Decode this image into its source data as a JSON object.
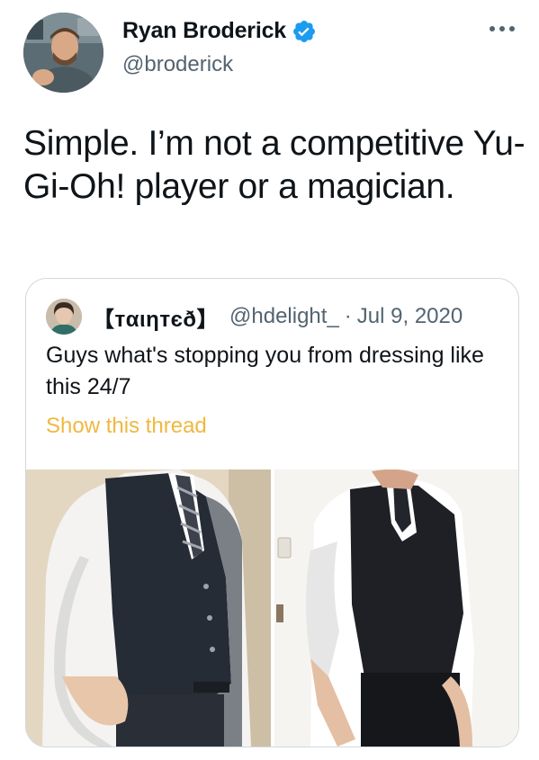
{
  "author": {
    "name": "Ryan Broderick",
    "handle": "@broderick",
    "verified": true,
    "avatar_icon": "profile-photo-icon"
  },
  "more_icon": "more-horizontal-icon",
  "tweet": {
    "text": "Simple. I’m not a competitive Yu-Gi-Oh! player or a magician."
  },
  "quoted_tweet": {
    "name": "【тαιηтєð】",
    "handle": "@hdelight_",
    "separator": "·",
    "date": "Jul 9, 2020",
    "text": "Guys what's stopping you from dressing like this 24/7",
    "show_thread_label": "Show this thread",
    "photos": [
      {
        "icon": "photo-vest-mirror-icon"
      },
      {
        "icon": "photo-vest-standing-icon"
      }
    ]
  },
  "colors": {
    "text_primary": "#0f1419",
    "text_secondary": "#536471",
    "verified_blue": "#1d9bf0",
    "show_thread": "#f0b840",
    "border": "#cfd9de"
  }
}
